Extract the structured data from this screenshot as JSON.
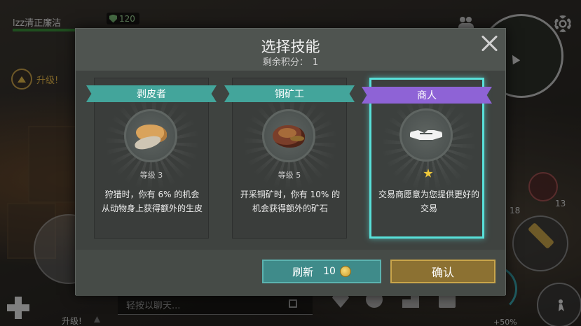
{
  "hud": {
    "player_name": "lzz清正廉洁",
    "shield_value": "120",
    "upgrade_label": "升级!",
    "upgrade_bottom_label": "升级!",
    "chat_placeholder": "轻按以聊天...",
    "count_a": "18",
    "count_b": "13",
    "percent_label": "+50%"
  },
  "modal": {
    "title": "选择技能",
    "points_label": "剩余积分：",
    "points_value": "1"
  },
  "skills": [
    {
      "name": "剥皮者",
      "icon": "animal-skin-icon",
      "level": "等级 3",
      "description": "狩猎时，你有 6% 的机会从动物身上获得额外的生皮",
      "ribbon_color": "#43a59b",
      "selected": false
    },
    {
      "name": "铜矿工",
      "icon": "copper-ore-icon",
      "level": "等级 5",
      "description": "开采铜矿时，你有 10% 的机会获得额外的矿石",
      "ribbon_color": "#43a59b",
      "selected": false
    },
    {
      "name": "商人",
      "icon": "handshake-icon",
      "rating_stars": 1,
      "description": "交易商愿意为您提供更好的交易",
      "ribbon_color": "#8e63d6",
      "selected": true
    }
  ],
  "footer": {
    "refresh_label": "刷新",
    "refresh_cost": "10",
    "confirm_label": "确认"
  },
  "colors": {
    "accent_teal": "#43a59b",
    "accent_purple": "#8e63d6",
    "selected_border": "#58e0d9",
    "confirm_gold": "#c9a54a"
  }
}
